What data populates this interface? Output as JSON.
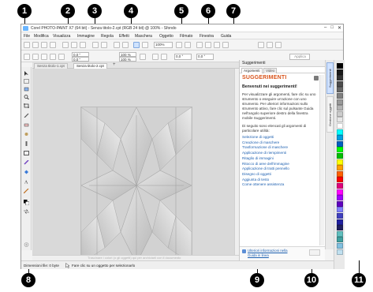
{
  "window": {
    "title": "Corel PHOTO-PAINT X7 (64 bit) - Senza titolo-2.cpt (RGB 24 bit) @ 100% - Sfondo",
    "controls": [
      "–",
      "□",
      "✕"
    ]
  },
  "menu": {
    "items": [
      "File",
      "Modifica",
      "Visualizza",
      "Immagine",
      "Regola",
      "Effetti",
      "Maschera",
      "Oggetto",
      "Filmato",
      "Finestra",
      "Guida"
    ]
  },
  "toolbar": {
    "zoom_value": "100%"
  },
  "property_bar": {
    "x_value": "0,0 \"",
    "y_value": "0,0 \"",
    "w_value": "100 %",
    "h_value": "100 %",
    "angle1_value": "0,0 °",
    "angle2_value": "0,0 °",
    "apply_label": "Applica"
  },
  "document_tabs": [
    {
      "label": "Senza titolo-1.cpt",
      "active": false
    },
    {
      "label": "Senza titolo-2.cpt",
      "active": true
    }
  ],
  "add_tab_glyph": "+",
  "status": {
    "size_label": "Dimensioni file: 0 byte",
    "hint": "Fare clic su un oggetto per selezionarlo",
    "watermark_hint": "Trascinare i colori (o gli oggetti) qui per archiviarli con il documento"
  },
  "hints_panel": {
    "title": "Suggerimenti",
    "tabs": [
      "Argomenti",
      "Video"
    ],
    "heading": "SUGGERIMENTI",
    "welcome": "Benvenuti nei suggerimenti!",
    "intro": "Per visualizzare gli argomenti, fare clic su uno strumento o eseguire un'azione con uno strumento. Per ulteriori informazioni sullo strumento attivo, fare clic sul pulsante Guida nell'angolo superiore destro della finestra mobile Suggerimenti.",
    "list_intro": "Di seguito sono elencati gli argomenti di particolare utilità:",
    "links": [
      "Selezione di oggetti",
      "Creazione di maschere",
      "Trasformazione di maschere",
      "Applicazione di riempimenti",
      "Ritaglio di immagini",
      "Ritocco di aree dell'immagine",
      "Applicazione di tratti pennello",
      "Disegno di oggetti",
      "Aggiunta di testo",
      "Come ottenere assistenza"
    ],
    "footer_link": "Ulteriori informazioni nella Guida in linea"
  },
  "side_tabs": [
    "Suggerimenti",
    "Gestione oggetti"
  ],
  "palette": {
    "colors": [
      "#000000",
      "#1a1a1a",
      "#333333",
      "#4d4d4d",
      "#666666",
      "#808080",
      "#999999",
      "#b3b3b3",
      "#cccccc",
      "#e6e6e6",
      "#ffffff",
      "#00ffff",
      "#00a0e0",
      "#0060c0",
      "#00ff00",
      "#00c000",
      "#ffff00",
      "#ffa000",
      "#ff6000",
      "#ff0000",
      "#e0007a",
      "#ff00ff",
      "#a000ff",
      "#6000c0",
      "#8080ff",
      "#4040c0",
      "#2020a0",
      "#202060",
      "#60c0c0",
      "#40a0a0",
      "#80c0e0",
      "#c0e0f0"
    ]
  },
  "callouts": [
    "1",
    "2",
    "3",
    "4",
    "5",
    "6",
    "7",
    "8",
    "9",
    "10",
    "11"
  ]
}
